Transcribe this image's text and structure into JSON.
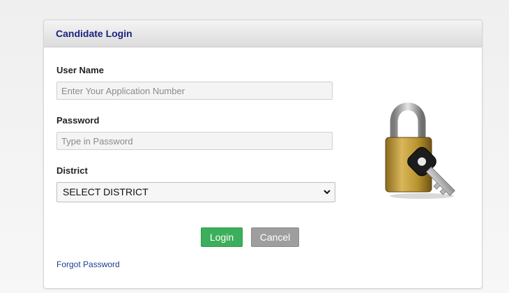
{
  "panel": {
    "title": "Candidate Login"
  },
  "form": {
    "username": {
      "label": "User Name",
      "placeholder": "Enter Your Application Number",
      "value": ""
    },
    "password": {
      "label": "Password",
      "placeholder": "Type in Password",
      "value": ""
    },
    "district": {
      "label": "District",
      "selected": "SELECT DISTRICT"
    }
  },
  "buttons": {
    "login": "Login",
    "cancel": "Cancel"
  },
  "links": {
    "forgot_password": "Forgot Password"
  },
  "colors": {
    "title": "#1a237e",
    "login_button": "#3cae5c",
    "cancel_button": "#9e9e9e",
    "link": "#1a3f8f"
  },
  "icons": {
    "illustration": "padlock-with-key-icon",
    "dropdown": "chevron-down-icon"
  }
}
